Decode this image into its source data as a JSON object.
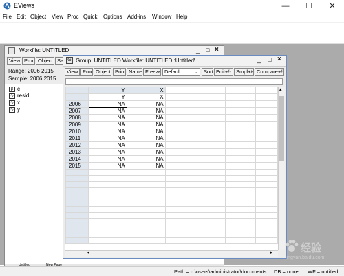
{
  "app": {
    "title": "EViews",
    "controls": [
      "—",
      "☐",
      "✕"
    ]
  },
  "menu": [
    "File",
    "Edit",
    "Object",
    "View",
    "Proc",
    "Quick",
    "Options",
    "Add-ins",
    "Window",
    "Help"
  ],
  "workfile": {
    "title": "Workfile: UNTITLED",
    "controls": [
      "_",
      "□",
      "×"
    ],
    "toolbar": [
      "View",
      "Proc",
      "Object",
      "Sa"
    ],
    "range": "Range:  2006 2015",
    "sample": "Sample: 2006 2015",
    "objects": [
      {
        "icon": "β",
        "name": "c"
      },
      {
        "icon": "∿",
        "name": "resid"
      },
      {
        "icon": "∿",
        "name": "x"
      },
      {
        "icon": "∿",
        "name": "y"
      }
    ],
    "tabs": [
      "Untitled",
      "New Page"
    ]
  },
  "group": {
    "title": "Group: UNTITLED   Workfile: UNTITLED::Untitled\\",
    "icon_letter": "G",
    "controls": [
      "_",
      "□",
      "×"
    ],
    "toolbar": [
      "View",
      "Proc",
      "Object",
      "Print",
      "Name",
      "Freeze",
      "Default",
      "Sort",
      "Edit+/-",
      "Smpl+/-",
      "Compare+/-"
    ],
    "edit_value": "",
    "columns": [
      "Y",
      "X"
    ],
    "name_row": [
      "Y",
      "X"
    ],
    "rows": [
      {
        "obs": "2006",
        "y": "NA",
        "x": "NA"
      },
      {
        "obs": "2007",
        "y": "NA",
        "x": "NA"
      },
      {
        "obs": "2008",
        "y": "NA",
        "x": "NA"
      },
      {
        "obs": "2009",
        "y": "NA",
        "x": "NA"
      },
      {
        "obs": "2010",
        "y": "NA",
        "x": "NA"
      },
      {
        "obs": "2011",
        "y": "NA",
        "x": "NA"
      },
      {
        "obs": "2012",
        "y": "NA",
        "x": "NA"
      },
      {
        "obs": "2013",
        "y": "NA",
        "x": "NA"
      },
      {
        "obs": "2014",
        "y": "NA",
        "x": "NA"
      },
      {
        "obs": "2015",
        "y": "NA",
        "x": "NA"
      }
    ]
  },
  "status": {
    "path": "Path = c:\\users\\administrator\\documents",
    "db": "DB = none",
    "wf": "WF = untitled"
  },
  "watermark": {
    "text": "经验",
    "url": "jingyan.baidu.com"
  }
}
